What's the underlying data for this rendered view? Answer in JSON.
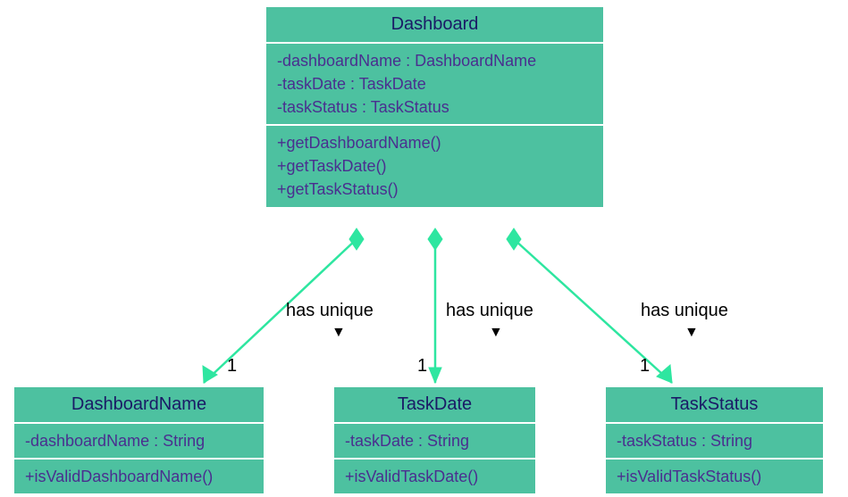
{
  "classes": {
    "dashboard": {
      "title": "Dashboard",
      "attributes": [
        "-dashboardName : DashboardName",
        "-taskDate : TaskDate",
        "-taskStatus : TaskStatus"
      ],
      "methods": [
        "+getDashboardName()",
        "+getTaskDate()",
        "+getTaskStatus()"
      ]
    },
    "dashboardName": {
      "title": "DashboardName",
      "attributes": [
        "-dashboardName : String"
      ],
      "methods": [
        "+isValidDashboardName()"
      ]
    },
    "taskDate": {
      "title": "TaskDate",
      "attributes": [
        "-taskDate : String"
      ],
      "methods": [
        "+isValidTaskDate()"
      ]
    },
    "taskStatus": {
      "title": "TaskStatus",
      "attributes": [
        "-taskStatus : String"
      ],
      "methods": [
        "+isValidTaskStatus()"
      ]
    }
  },
  "associations": [
    {
      "label": "has unique",
      "multiplicity": "1"
    },
    {
      "label": "has unique",
      "multiplicity": "1"
    },
    {
      "label": "has unique",
      "multiplicity": "1"
    }
  ],
  "direction_marker": "▼",
  "colors": {
    "class_fill": "#4dc1a0",
    "class_border": "#ffffff",
    "title_text": "#1a1a66",
    "member_text": "#4a2f8f",
    "connector": "#2ee6a0",
    "label_text": "#000000"
  }
}
